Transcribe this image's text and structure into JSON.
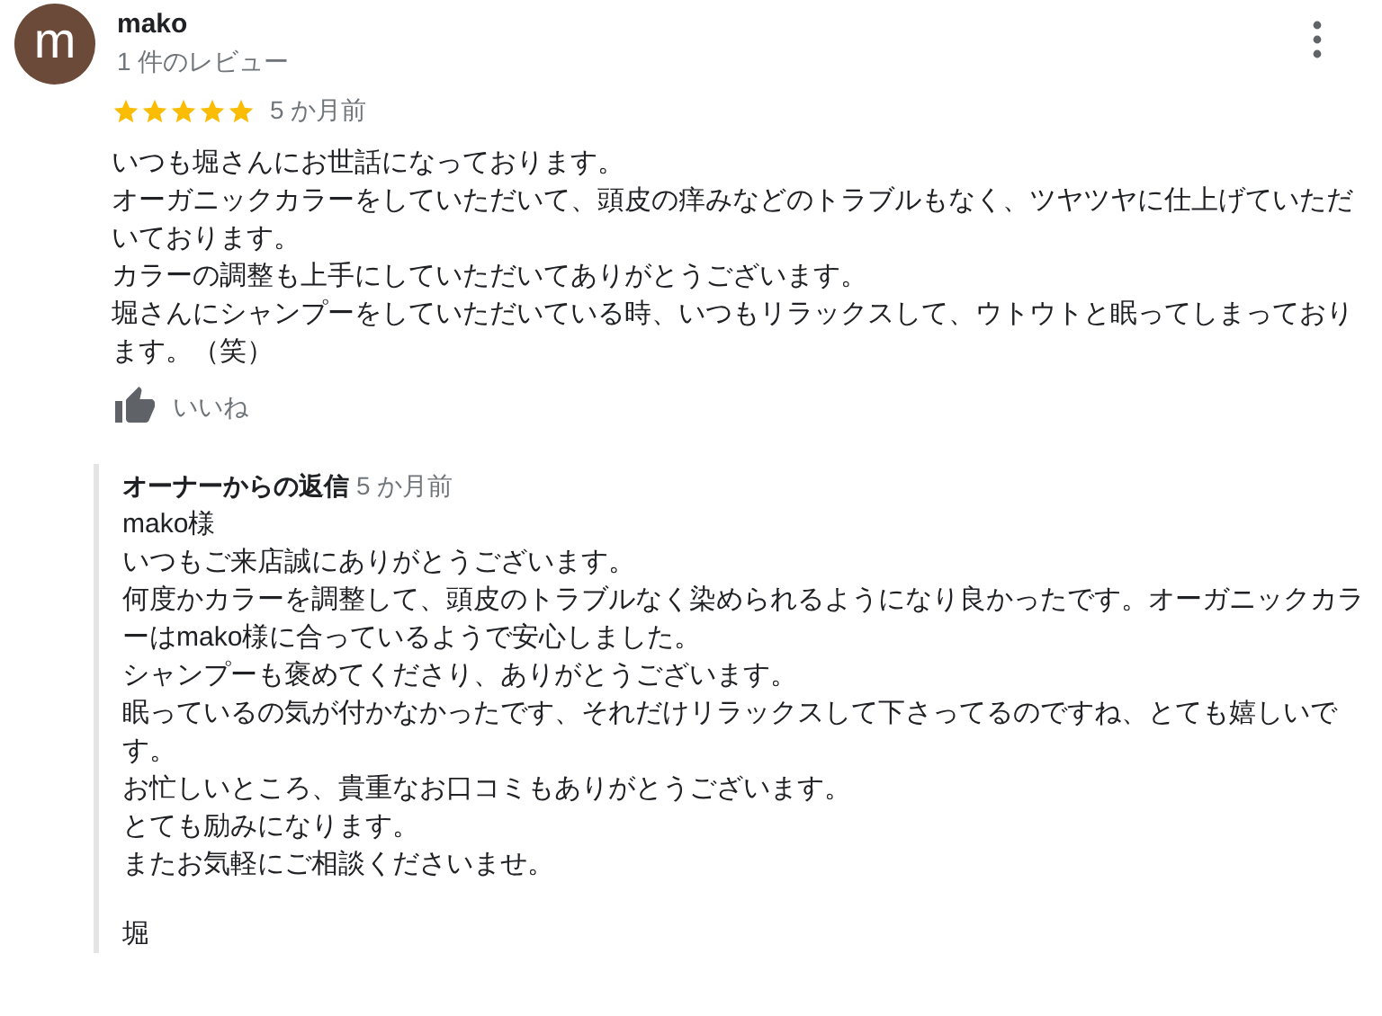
{
  "reviewer": {
    "avatar_letter": "m",
    "name": "mako",
    "review_count": "1 件のレビュー"
  },
  "rating": {
    "stars": 5,
    "time": "5 か月前"
  },
  "review_paragraphs": [
    "いつも堀さんにお世話になっております。",
    "オーガニックカラーをしていただいて、頭皮の痒みなどのトラブルもなく、ツヤツヤに仕上げていただいております。",
    "カラーの調整も上手にしていただいてありがとうございます。",
    "堀さんにシャンプーをしていただいている時、いつもリラックスして、ウトウトと眠ってしまっております。（笑）"
  ],
  "like": {
    "label": "いいね"
  },
  "owner_reply": {
    "title": "オーナーからの返信",
    "time": "5 か月前",
    "paragraphs": [
      "mako様",
      "いつもご来店誠にありがとうございます。",
      "何度かカラーを調整して、頭皮のトラブルなく染められるようになり良かったです。オーガニックカラーはmako様に合っているようで安心しました。",
      "シャンプーも褒めてくださり、ありがとうございます。",
      "眠っているの気が付かなかったです、それだけリラックスして下さってるのですね、とても嬉しいです。",
      "お忙しいところ、貴重なお口コミもありがとうございます。",
      "とても励みになります。",
      "またお気軽にご相談くださいませ。"
    ],
    "signature": "堀"
  }
}
